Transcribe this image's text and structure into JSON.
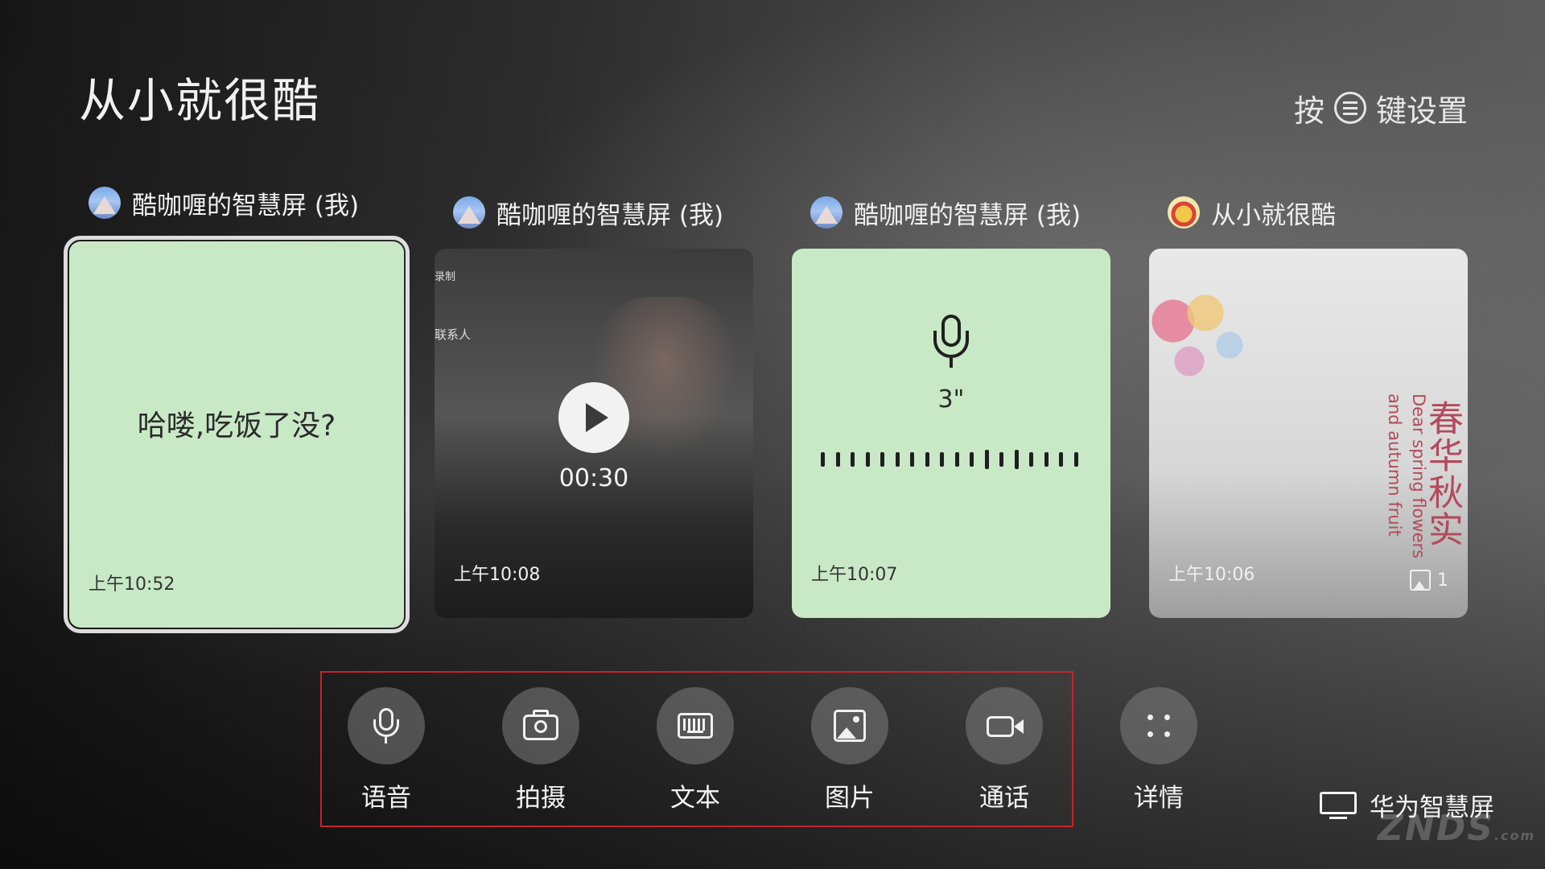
{
  "page": {
    "title": "从小就很酷"
  },
  "menu_hint": {
    "prefix": "按",
    "suffix": "键设置",
    "icon": "menu-icon"
  },
  "messages": [
    {
      "sender": "酷咖喱的智慧屏 (我)",
      "avatar": "mountain-avatar",
      "kind": "text",
      "text": "哈喽,吃饭了没?",
      "time": "上午10:52",
      "selected": true
    },
    {
      "sender": "酷咖喱的智慧屏 (我)",
      "avatar": "mountain-avatar",
      "kind": "video",
      "duration": "00:30",
      "overlay_a": "录制",
      "overlay_b": "联系人",
      "time": "上午10:08"
    },
    {
      "sender": "酷咖喱的智慧屏 (我)",
      "avatar": "mountain-avatar",
      "kind": "voice",
      "length": "3\"",
      "time": "上午10:07"
    },
    {
      "sender": "从小就很酷",
      "avatar": "sun-avatar",
      "kind": "image",
      "cn_text": "春华秋实",
      "en_line1": "Dear spring flowers",
      "en_line2": "and autumn fruit",
      "count": "1",
      "time": "上午10:06"
    }
  ],
  "actions": [
    {
      "label": "语音",
      "icon": "mic-icon"
    },
    {
      "label": "拍摄",
      "icon": "camera-icon"
    },
    {
      "label": "文本",
      "icon": "keyboard-icon"
    },
    {
      "label": "图片",
      "icon": "image-icon"
    },
    {
      "label": "通话",
      "icon": "video-call-icon"
    },
    {
      "label": "详情",
      "icon": "dots-icon"
    }
  ],
  "brand": {
    "label": "华为智慧屏",
    "watermark": "ZNDS",
    "watermark_suffix": ".com"
  },
  "colors": {
    "card_green": "#c9e9c6",
    "focus_box": "#c8222b",
    "photo_text": "#b24a5c"
  }
}
